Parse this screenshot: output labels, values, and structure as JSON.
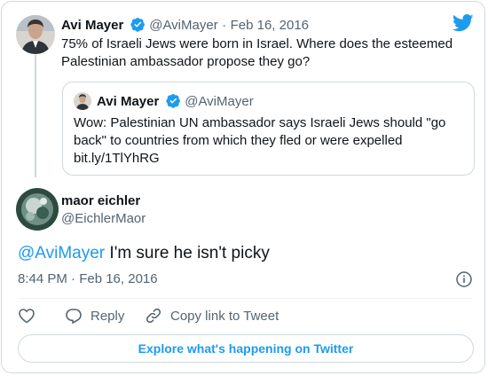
{
  "tweet": {
    "author_name": "Avi Mayer",
    "author_handle": "@AviMayer",
    "separator": "·",
    "date": "Feb 16, 2016",
    "text_line1": "75% of Israeli Jews were born in Israel. Where does the esteemed",
    "text_line2": "Palestinian ambassador propose they go?"
  },
  "quoted": {
    "author_name": "Avi Mayer",
    "author_handle": "@AviMayer",
    "text_line1": "Wow: Palestinian UN ambassador says Israeli Jews should \"go",
    "text_line2": "back\" to countries from which they fled or were expelled",
    "text_line3": "bit.ly/1TlYhRG"
  },
  "reply": {
    "author_name": "maor eichler",
    "author_handle": "@EichlerMaor",
    "mention": "@AviMayer",
    "text": " I'm sure he isn't picky",
    "time": "8:44 PM · Feb 16, 2016"
  },
  "actions": {
    "reply_label": "Reply",
    "copy_label": "Copy link to Tweet"
  },
  "explore_label": "Explore what's happening on Twitter",
  "colors": {
    "brand": "#1d9bf0",
    "text": "#0f1419",
    "muted": "#536471",
    "border": "#cfd9de"
  },
  "icons": [
    "twitter-bird-icon",
    "verified-badge-icon",
    "info-icon",
    "heart-icon",
    "reply-icon",
    "link-icon"
  ]
}
